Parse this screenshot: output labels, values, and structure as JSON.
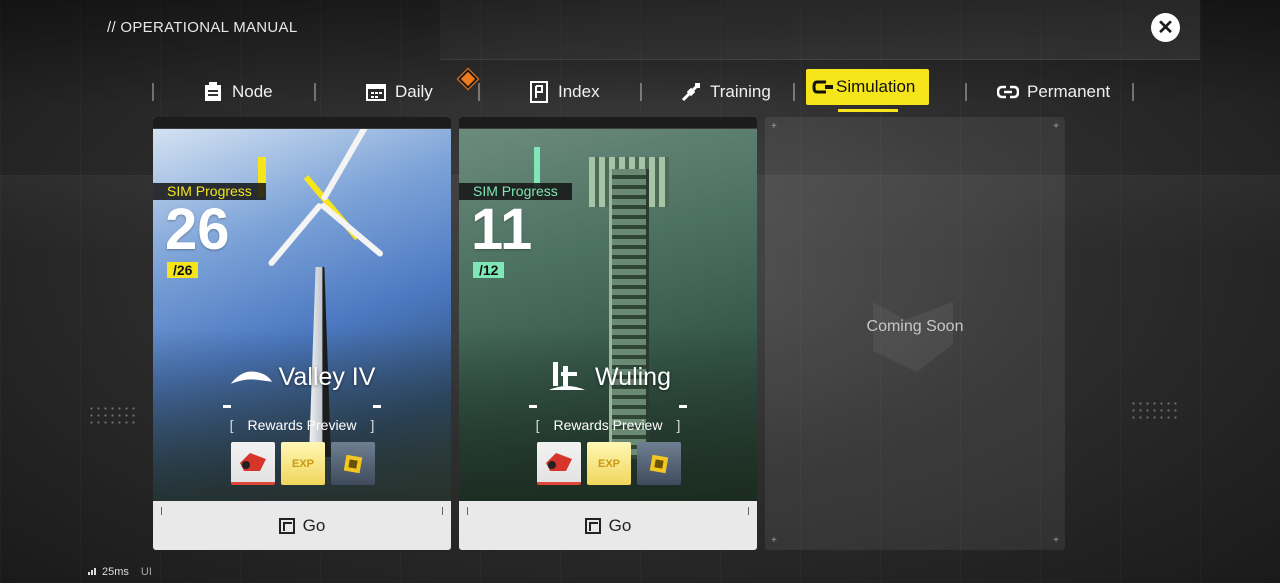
{
  "header": {
    "title": "// OPERATIONAL MANUAL"
  },
  "tabs": [
    {
      "label": "Node",
      "icon": "node-icon",
      "active": false
    },
    {
      "label": "Daily",
      "icon": "calendar-icon",
      "active": false
    },
    {
      "label": "Index",
      "icon": "index-icon",
      "active": false,
      "badge": true
    },
    {
      "label": "Training",
      "icon": "training-icon",
      "active": false
    },
    {
      "label": "Simulation",
      "icon": "simulation-icon",
      "active": true
    },
    {
      "label": "Permanent",
      "icon": "link-icon",
      "active": false
    }
  ],
  "cards": [
    {
      "region": "Valley IV",
      "progress_label": "SIM Progress",
      "progress_count": "26",
      "progress_total": "/26",
      "rewards_label": "Rewards Preview",
      "rewards": [
        "red-item-icon",
        "exp-icon",
        "gold-item-icon"
      ],
      "reward_exp_text": "EXP",
      "go_label": "Go",
      "accent": "#f5e51a"
    },
    {
      "region": "Wuling",
      "progress_label": "SIM Progress",
      "progress_count": "11",
      "progress_total": "/12",
      "rewards_label": "Rewards Preview",
      "rewards": [
        "red-item-icon",
        "exp-icon",
        "gold-item-icon"
      ],
      "reward_exp_text": "EXP",
      "go_label": "Go",
      "accent": "#7fe6b8"
    }
  ],
  "coming_soon": {
    "label": "Coming Soon"
  },
  "status": {
    "ping": "25ms",
    "tag": "UI"
  },
  "colors": {
    "active_tab": "#f5e51a",
    "badge": "#f07a1c"
  }
}
